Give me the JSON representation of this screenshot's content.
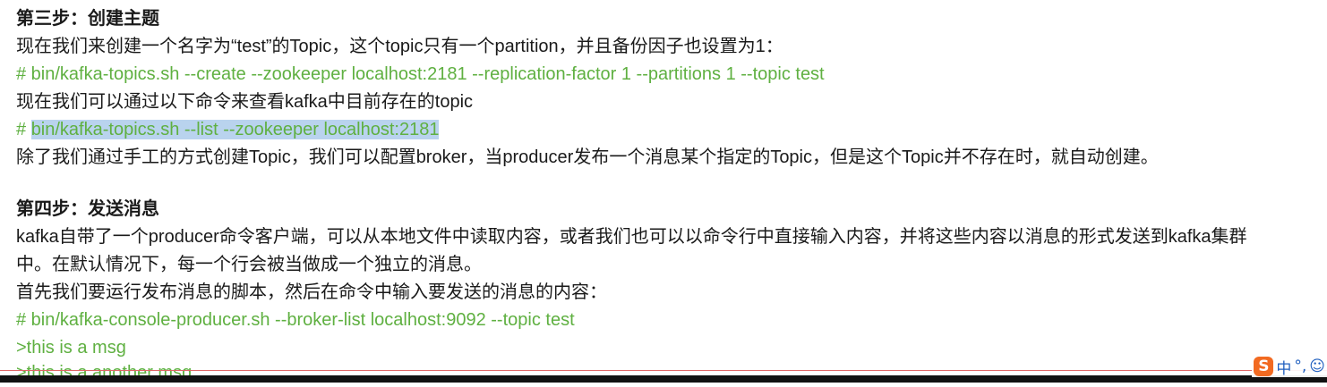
{
  "sections": {
    "step3": {
      "heading": "第三步：创建主题",
      "line1": "现在我们来创建一个名字为“test”的Topic，这个topic只有一个partition，并且备份因子也设置为1：",
      "code1": "# bin/kafka-topics.sh --create --zookeeper localhost:2181 --replication-factor 1 --partitions 1 --topic test",
      "line2": "现在我们可以通过以下命令来查看kafka中目前存在的topic",
      "code2_prefix": "# ",
      "code2_selected": "bin/kafka-topics.sh --list --zookeeper localhost:2181",
      "line3": "除了我们通过手工的方式创建Topic，我们可以配置broker，当producer发布一个消息某个指定的Topic，但是这个Topic并不存在时，就自动创建。"
    },
    "step4": {
      "heading": "第四步：发送消息",
      "para1_line1": "kafka自带了一个producer命令客户端，可以从本地文件中读取内容，或者我们也可以以命令行中直接输入内容，并将这些内容以消息的形式发送到kafka集群",
      "para1_line2": "中。在默认情况下，每一个行会被当做成一个独立的消息。",
      "line2": "首先我们要运行发布消息的脚本，然后在命令中输入要发送的消息的内容：",
      "code1": "# bin/kafka-console-producer.sh --broker-list localhost:9092 --topic test",
      "code2": ">this is a msg",
      "code3_partial": ">this is a another msg"
    }
  },
  "ime_toolbar": {
    "logo": "S",
    "lang": "中",
    "punct": "°,",
    "emoji": "☺"
  },
  "colors": {
    "code": "#5fb041",
    "selection": "#b9d3ee",
    "ime_logo": "#f26a21"
  }
}
